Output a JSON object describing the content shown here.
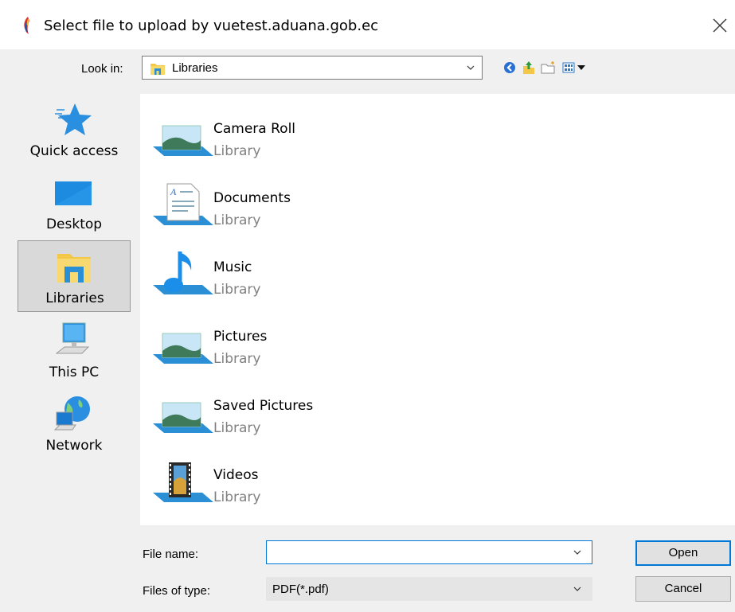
{
  "window": {
    "title": "Select file to upload by vuetest.aduana.gob.ec"
  },
  "look_in": {
    "label": "Look in:",
    "value": "Libraries"
  },
  "toolbar_icons": [
    "back-icon",
    "up-folder-icon",
    "new-folder-icon",
    "view-menu-icon"
  ],
  "places": [
    {
      "label": "Quick access",
      "icon": "star-icon"
    },
    {
      "label": "Desktop",
      "icon": "desktop-icon"
    },
    {
      "label": "Libraries",
      "icon": "libraries-icon",
      "selected": true
    },
    {
      "label": "This PC",
      "icon": "computer-icon"
    },
    {
      "label": "Network",
      "icon": "network-icon"
    }
  ],
  "files": [
    {
      "name": "Camera Roll",
      "type": "Library",
      "icon": "picture-library-icon"
    },
    {
      "name": "Documents",
      "type": "Library",
      "icon": "documents-library-icon"
    },
    {
      "name": "Music",
      "type": "Library",
      "icon": "music-library-icon"
    },
    {
      "name": "Pictures",
      "type": "Library",
      "icon": "picture-library-icon"
    },
    {
      "name": "Saved Pictures",
      "type": "Library",
      "icon": "picture-library-icon"
    },
    {
      "name": "Videos",
      "type": "Library",
      "icon": "video-library-icon"
    }
  ],
  "file_name": {
    "label": "File name:",
    "value": ""
  },
  "file_type": {
    "label": "Files of type:",
    "value": "PDF(*.pdf)"
  },
  "buttons": {
    "open": "Open",
    "cancel": "Cancel"
  },
  "colors": {
    "accent": "#0078d7",
    "library_blue": "#2b8fd6",
    "sidebar_bg": "#f0f0f0",
    "list_bg": "#ffffff"
  }
}
